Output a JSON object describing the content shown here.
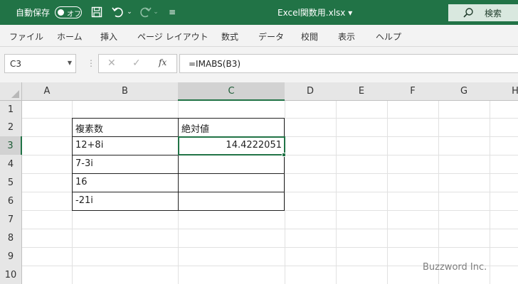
{
  "titlebar": {
    "autosave_label": "自動保存",
    "autosave_state": "オフ",
    "filename": "Excel関数用.xlsx ▾",
    "search_label": "検索",
    "accent_color": "#217346"
  },
  "menu": {
    "items": [
      "ファイル",
      "ホーム",
      "挿入",
      "ページ レイアウト",
      "数式",
      "データ",
      "校閲",
      "表示",
      "ヘルプ"
    ]
  },
  "formula_bar": {
    "name_box": "C3",
    "fx_label": "fx",
    "formula": "=IMABS(B3)"
  },
  "sheet": {
    "columns": [
      "A",
      "B",
      "C",
      "D",
      "E",
      "F",
      "G",
      "H"
    ],
    "rows": [
      "1",
      "2",
      "3",
      "4",
      "5",
      "6",
      "7",
      "8",
      "9",
      "10"
    ],
    "selected_cell": "C3",
    "table": {
      "headers": [
        "複素数",
        "絶対値"
      ],
      "rows": [
        [
          "12+8i",
          "14.4222051"
        ],
        [
          "7-3i",
          ""
        ],
        [
          "16",
          ""
        ],
        [
          "-21i",
          ""
        ]
      ]
    }
  },
  "watermark": "Buzzword Inc."
}
